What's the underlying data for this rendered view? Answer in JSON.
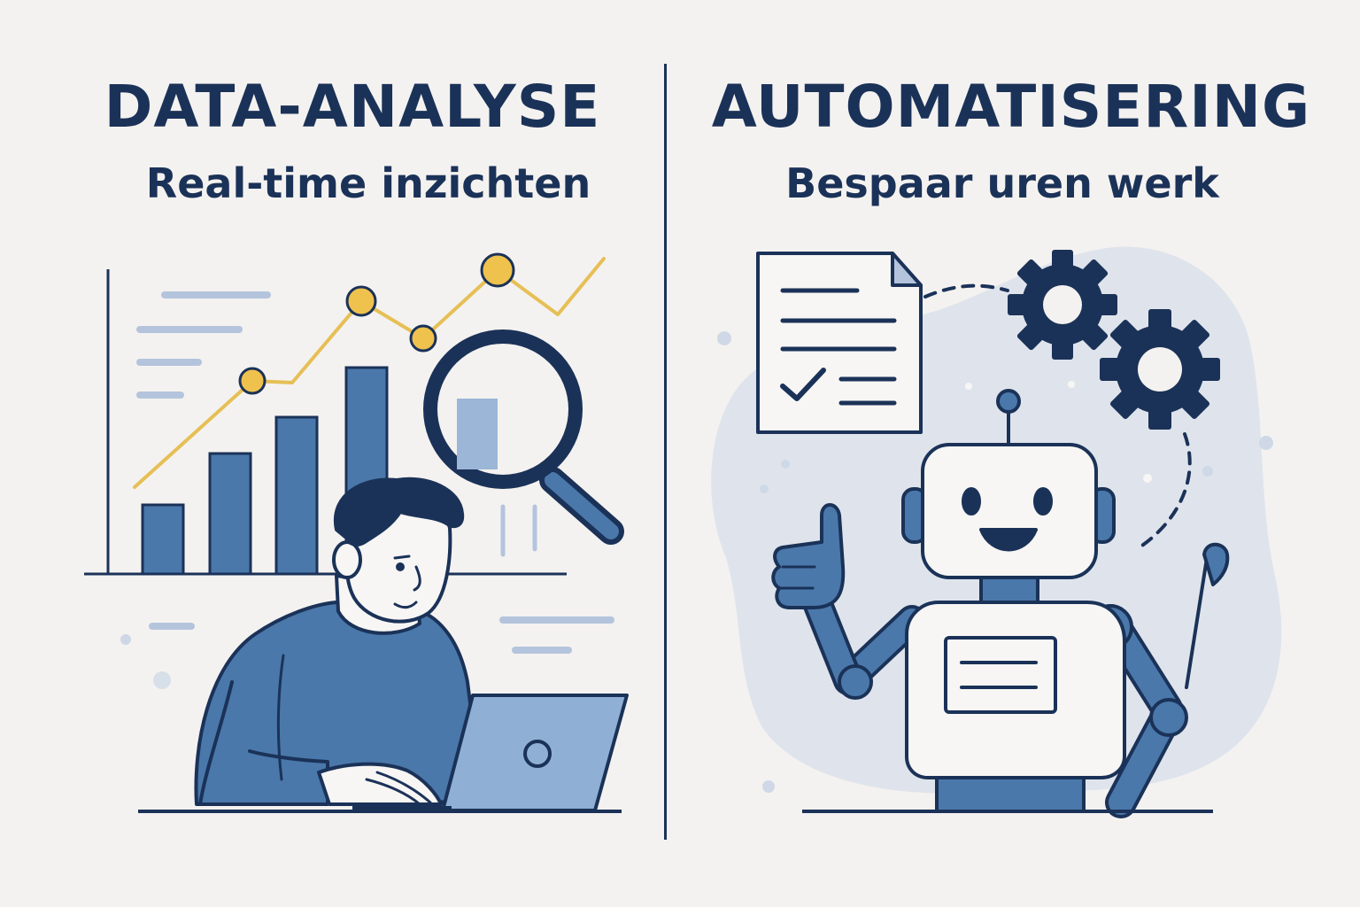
{
  "left": {
    "title": "DATA-ANALYSE",
    "subtitle": "Real-time inzichten"
  },
  "right": {
    "title": "AUTOMATISERING",
    "subtitle": "Bespaar uren werk"
  },
  "colors": {
    "background": "#f4f2f0",
    "navy": "#1b3258",
    "blue": "#4a78aa",
    "light_blue": "#8fb0d4",
    "pale_blue": "#dfe4ec",
    "yellow": "#e6bf55",
    "white": "#f7f6f4"
  },
  "icons": [
    "bar-chart-icon",
    "trend-line-icon",
    "magnifier-icon",
    "laptop-icon",
    "document-check-icon",
    "gear-icon",
    "robot-icon"
  ]
}
